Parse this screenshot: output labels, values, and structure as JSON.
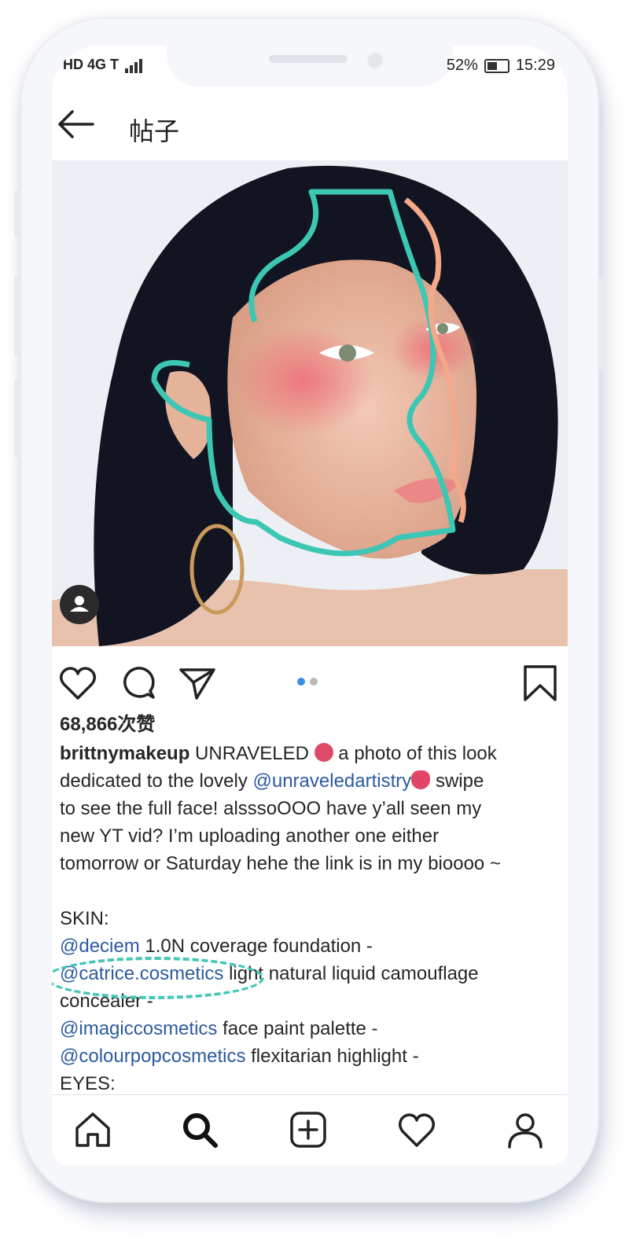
{
  "status_bar": {
    "left_text": "HD 4G T",
    "battery_percent": "52%",
    "time": "15:29"
  },
  "header": {
    "title": "帖子"
  },
  "post": {
    "carousel": {
      "count": 2,
      "active_index": 0
    },
    "likes": "68,866次赞",
    "username": "brittnymakeup",
    "caption_lines": [
      " UNRAVELED ",
      " a photo of this look",
      "dedicated to the lovely ",
      "@unraveledartistry",
      " swipe",
      "to see the full face! alsssoOOO have y’all seen my",
      "new YT vid? I’m uploading another one either",
      "tomorrow or Saturday hehe the link is in my bioooo ~"
    ],
    "skin_heading": "SKIN:",
    "products": [
      {
        "mention": "@deciem",
        "text": " 1.0N coverage foundation -"
      },
      {
        "mention": "@catrice.cosmetics",
        "text": " light natural liquid camouflage"
      },
      {
        "mention": "",
        "text": "concealer -"
      },
      {
        "mention": "@imagiccosmetics",
        "text": " face paint palette -"
      },
      {
        "mention": "@colourpopcosmetics",
        "text": " flexitarian highlight -"
      }
    ],
    "eyes_heading": "EYES:"
  },
  "colors": {
    "accent_mention": "#2d5aa0",
    "highlight_ring": "#42c7b8",
    "carousel_active": "#3b8fe6"
  },
  "icons": {
    "back": "arrow-left-icon",
    "like": "heart-icon",
    "comment": "comment-bubble-icon",
    "share": "paper-plane-icon",
    "save": "bookmark-icon",
    "tab_home": "home-icon",
    "tab_search": "search-icon",
    "tab_add": "plus-square-icon",
    "tab_activity": "heart-icon",
    "tab_profile": "person-icon"
  }
}
